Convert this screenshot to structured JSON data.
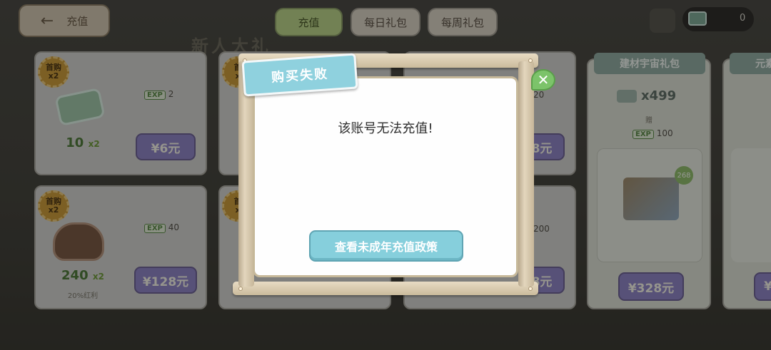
{
  "header": {
    "back_label": "充值",
    "tabs": [
      {
        "label": "充值",
        "active": true
      },
      {
        "label": "每日礼包",
        "active": false
      },
      {
        "label": "每周礼包",
        "active": false
      }
    ],
    "currency_count": "0"
  },
  "banner_title": "新人大礼",
  "cards": [
    {
      "badge_line1": "首购",
      "badge_line2": "x2",
      "amount": "10",
      "mult": "x2",
      "exp": "2",
      "price": "¥6元"
    },
    {
      "badge_line1": "首购",
      "badge_line2": "x2",
      "amount": "240",
      "mult": "x2",
      "bonus": "20%红利",
      "exp": "40",
      "price": "¥128元"
    }
  ],
  "partial_cards": [
    {
      "badge_line1": "首",
      "badge_line2": "x"
    },
    {
      "badge_line1": "首",
      "badge_line2": "x"
    }
  ],
  "partial_right": {
    "exp_top": "20",
    "price_top": "8元",
    "exp_bottom": "200",
    "price_bottom": "8元"
  },
  "pack": {
    "title": "建材宇宙礼包",
    "qty": "x499",
    "plus": "赠",
    "exp": "100",
    "item_count": "268",
    "price": "¥328元"
  },
  "next_pack_title": "元素",
  "dialog": {
    "title": "购买失败",
    "message": "该账号无法充值!",
    "button": "查看未成年充值政策"
  },
  "colors": {
    "dialog_title_bg": "#8fd1de",
    "dialog_button_bg": "#86cfdc",
    "close_bg": "#7cc36a",
    "price_bg": "#8d83c2"
  }
}
